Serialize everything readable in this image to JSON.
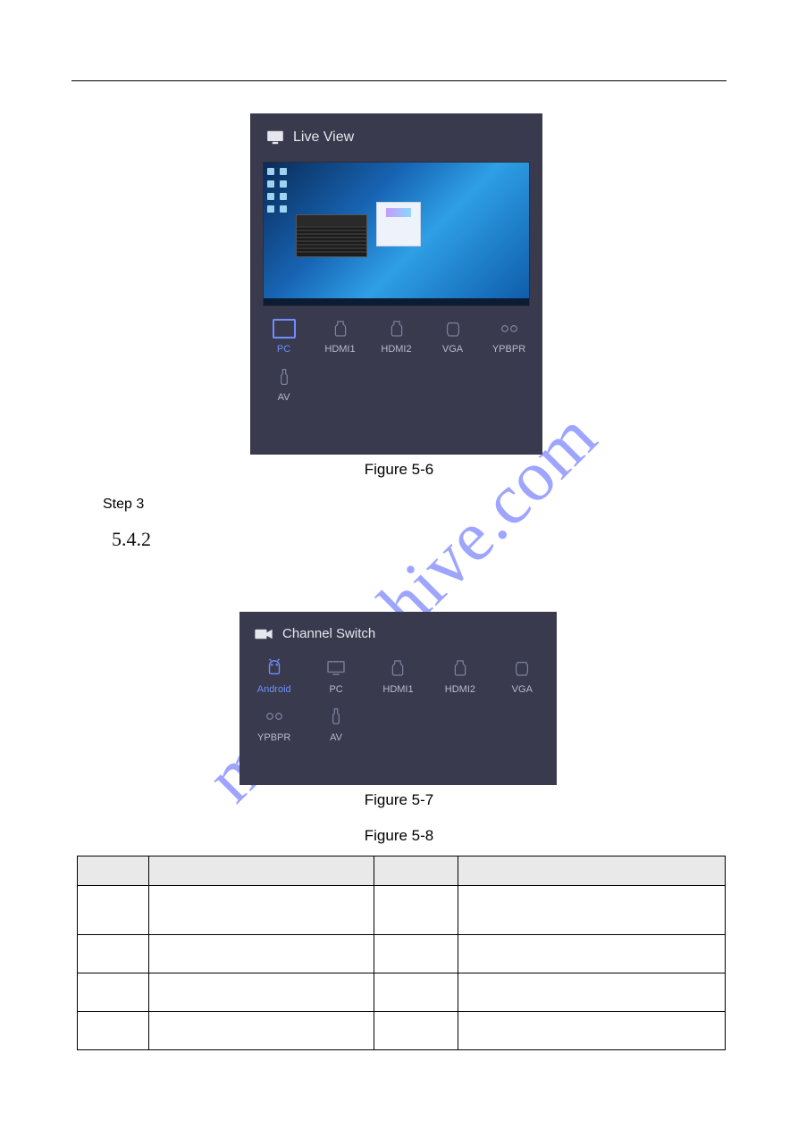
{
  "figure56": {
    "panel_title": "Live View",
    "sources": [
      {
        "label": "PC",
        "icon": "pc-icon",
        "active": true
      },
      {
        "label": "HDMI1",
        "icon": "hdmi-plug-icon",
        "active": false
      },
      {
        "label": "HDMI2",
        "icon": "hdmi-plug-icon",
        "active": false
      },
      {
        "label": "VGA",
        "icon": "vga-plug-icon",
        "active": false
      },
      {
        "label": "YPBPR",
        "icon": "component-icon",
        "active": false
      },
      {
        "label": "AV",
        "icon": "av-plug-icon",
        "active": false
      }
    ],
    "caption": "Figure 5-6"
  },
  "step3": "Step 3",
  "section_number": "5.4.2",
  "figure57": {
    "panel_title": "Channel Switch",
    "sources": [
      {
        "label": "Android",
        "icon": "android-icon",
        "active": true
      },
      {
        "label": "PC",
        "icon": "pc-icon",
        "active": false
      },
      {
        "label": "HDMI1",
        "icon": "hdmi-plug-icon",
        "active": false
      },
      {
        "label": "HDMI2",
        "icon": "hdmi-plug-icon",
        "active": false
      },
      {
        "label": "VGA",
        "icon": "vga-plug-icon",
        "active": false
      },
      {
        "label": "YPBPR",
        "icon": "component-icon",
        "active": false
      },
      {
        "label": "AV",
        "icon": "av-plug-icon",
        "active": false
      }
    ],
    "caption": "Figure 5-7"
  },
  "figure58_caption": "Figure 5-8",
  "watermark": "manualshive.com",
  "table": {
    "headers": [
      "",
      "",
      "",
      ""
    ],
    "rows": [
      [
        "",
        "",
        "",
        ""
      ],
      [
        "",
        "",
        "",
        ""
      ],
      [
        "",
        "",
        "",
        ""
      ],
      [
        "",
        "",
        "",
        ""
      ]
    ]
  }
}
